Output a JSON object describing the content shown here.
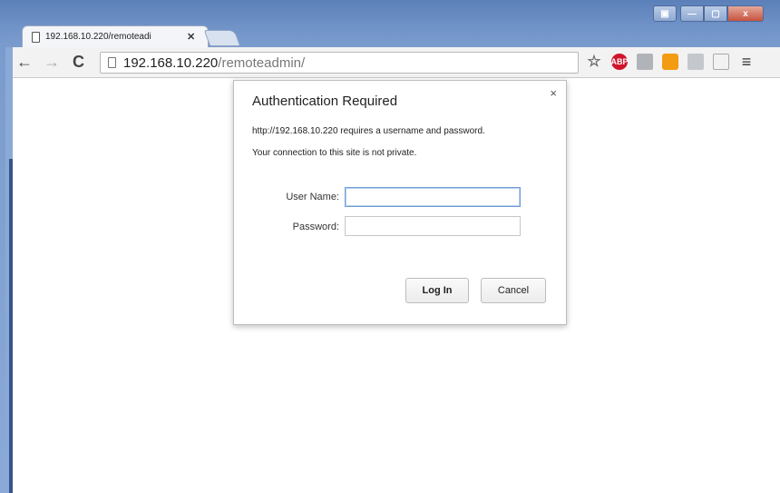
{
  "tab": {
    "title": "192.168.10.220/remoteadi",
    "close": "✕"
  },
  "window_controls": {
    "remote": "▣",
    "minimize": "—",
    "maximize": "▢",
    "close": "x"
  },
  "toolbar": {
    "back": "←",
    "forward": "→",
    "reload": "C",
    "url_host": "192.168.10.220",
    "url_path": "/remoteadmin/",
    "extensions": {
      "star": "☆",
      "abp": "ABP",
      "menu": "≡"
    }
  },
  "dialog": {
    "title": "Authentication Required",
    "close": "×",
    "message_line1": "http://192.168.10.220 requires a username and password.",
    "message_line2": "Your connection to this site is not private.",
    "username_label": "User Name:",
    "username_value": "",
    "password_label": "Password:",
    "password_value": "",
    "login_label": "Log In",
    "cancel_label": "Cancel"
  },
  "colors": {
    "frame": "#6f92c7",
    "toolbar": "#f2f2f2",
    "focus_border": "#6e9bd6",
    "abp_red": "#d0142b",
    "rss_orange": "#f39c12"
  }
}
